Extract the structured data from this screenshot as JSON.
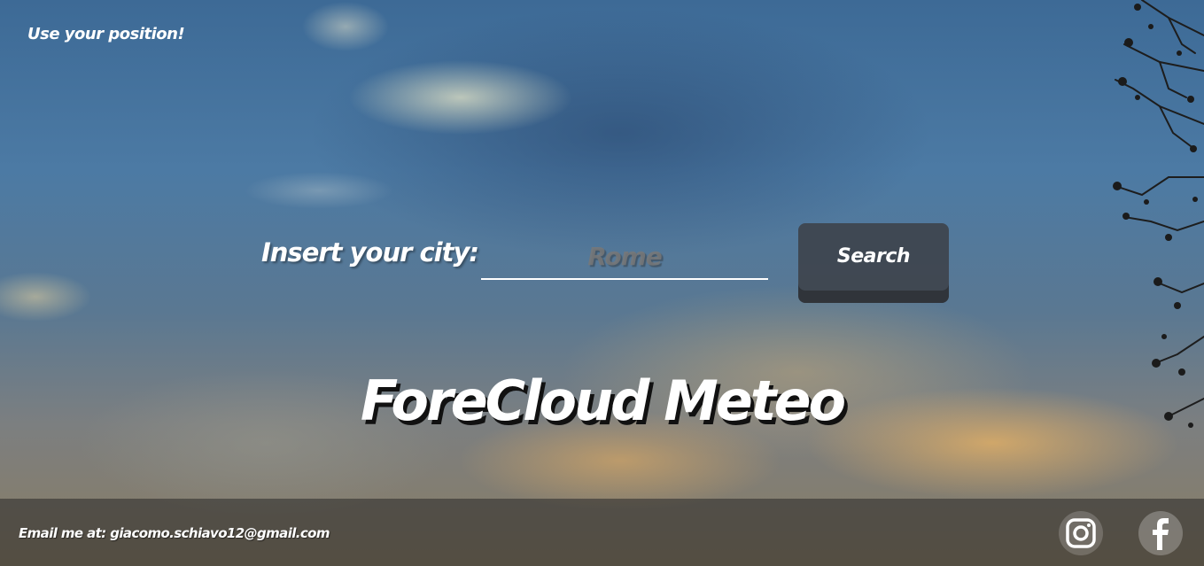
{
  "page": {
    "geo_link": "Use your position!",
    "search": {
      "label": "Insert your city:",
      "placeholder": "Rome",
      "value": "",
      "button_label": "Search"
    },
    "brand_title": "ForeCloud Meteo",
    "footer": {
      "email_prefix": "Email me at:",
      "email_address": "giacomo.schiavo12@gmail.com",
      "social": [
        {
          "name": "instagram",
          "icon": "instagram-icon"
        },
        {
          "name": "facebook",
          "icon": "facebook-icon"
        }
      ]
    }
  },
  "colors": {
    "text": "#ffffff",
    "button_bg": "#3c4046",
    "footer_bg": "#282828",
    "title_shadow": "#111111"
  }
}
